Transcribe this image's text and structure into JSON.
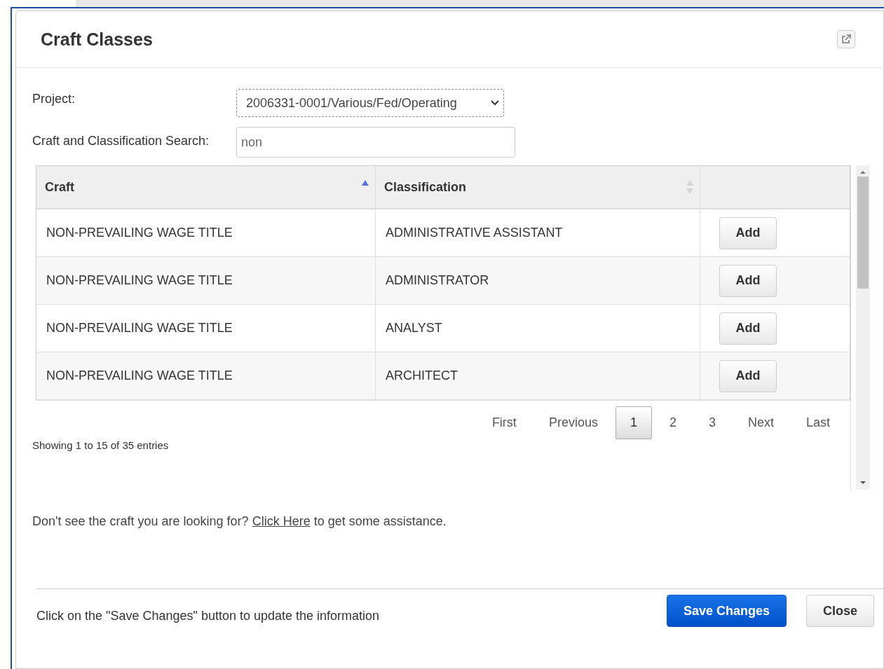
{
  "dialog": {
    "title": "Craft Classes"
  },
  "form": {
    "project_label": "Project:",
    "project_value": "2006331-0001/Various/Fed/Operating",
    "search_label": "Craft and Classification Search:",
    "search_value": "non"
  },
  "table": {
    "columns": [
      {
        "label": "Craft",
        "sorted": true
      },
      {
        "label": "Classification",
        "sorted": false
      }
    ],
    "rows": [
      {
        "craft": "NON-PREVAILING WAGE TITLE",
        "classification": "ADMINISTRATIVE ASSISTANT",
        "action": "Add"
      },
      {
        "craft": "NON-PREVAILING WAGE TITLE",
        "classification": "ADMINISTRATOR",
        "action": "Add"
      },
      {
        "craft": "NON-PREVAILING WAGE TITLE",
        "classification": "ANALYST",
        "action": "Add"
      },
      {
        "craft": "NON-PREVAILING WAGE TITLE",
        "classification": "ARCHITECT",
        "action": "Add"
      }
    ]
  },
  "pagination": {
    "first": "First",
    "previous": "Previous",
    "pages": [
      {
        "label": "1",
        "selected": true
      },
      {
        "label": "2",
        "selected": false
      },
      {
        "label": "3",
        "selected": false
      }
    ],
    "next": "Next",
    "last": "Last"
  },
  "info": "Showing 1 to 15 of 35 entries",
  "help": {
    "before": "Don't see the craft you are looking for?",
    "link": "Click Here",
    "after": "to get some assistance."
  },
  "footer": {
    "note": "Click on the \"Save Changes\" button to update the information",
    "save": "Save Changes",
    "close": "Close"
  }
}
